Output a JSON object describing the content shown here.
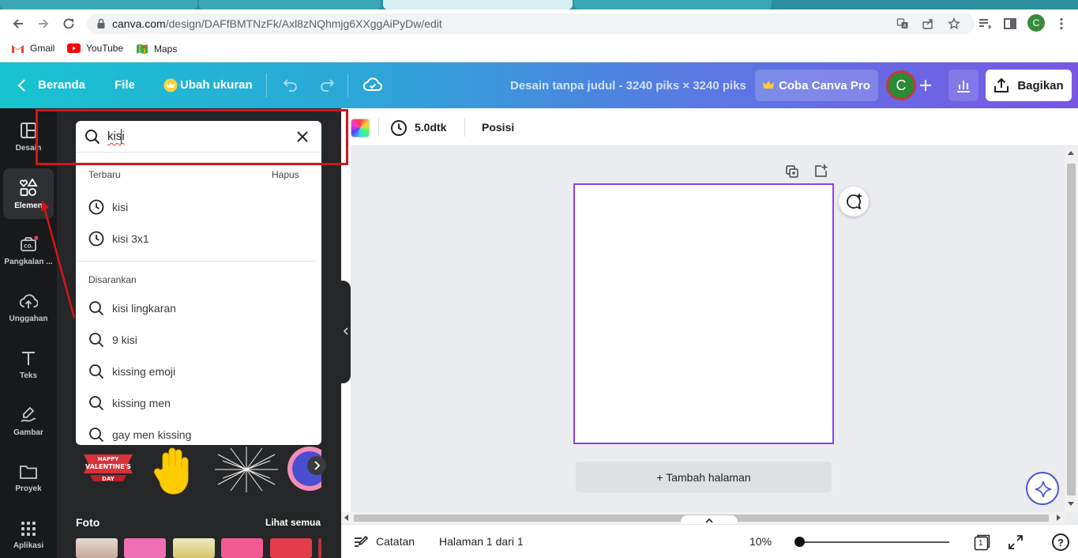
{
  "browser": {
    "url_host": "canva.com",
    "url_path": "/design/DAFfBMTNzFk/Axl8zNQhmjg6XXggAiPyDw/edit",
    "profile_initial": "C",
    "bookmarks": [
      {
        "label": "Gmail",
        "icon": "gmail-icon"
      },
      {
        "label": "YouTube",
        "icon": "youtube-icon"
      },
      {
        "label": "Maps",
        "icon": "maps-icon"
      }
    ]
  },
  "header": {
    "home_label": "Beranda",
    "file_label": "File",
    "resize_label": "Ubah ukuran",
    "design_title": "Desain tanpa judul - 3240 piks × 3240 piks",
    "pro_label": "Coba Canva Pro",
    "avatar_initial": "C",
    "share_label": "Bagikan"
  },
  "rail": [
    {
      "label": "Desain",
      "icon": "layout-icon"
    },
    {
      "label": "Elemen",
      "icon": "shapes-icon",
      "active": true
    },
    {
      "label": "Pangkalan ...",
      "icon": "brand-kit-icon"
    },
    {
      "label": "Unggahan",
      "icon": "cloud-upload-icon"
    },
    {
      "label": "Teks",
      "icon": "text-icon"
    },
    {
      "label": "Gambar",
      "icon": "draw-icon"
    },
    {
      "label": "Proyek",
      "icon": "folder-icon"
    },
    {
      "label": "Aplikasi",
      "icon": "apps-grid-icon"
    }
  ],
  "search": {
    "value": "kisi",
    "recent_heading": "Terbaru",
    "clear_label": "Hapus",
    "recent": [
      "kisi",
      "kisi 3x1"
    ],
    "suggested_heading": "Disarankan",
    "suggested": [
      "kisi lingkaran",
      "9 kisi",
      "kissing emoji",
      "kissing men",
      "gay men kissing"
    ]
  },
  "panel": {
    "sticker_text": "HAPPY VALENTINE'S DAY",
    "photos_heading": "Foto",
    "see_all_label": "Lihat semua"
  },
  "toolbar": {
    "duration_label": "5.0dtk",
    "position_label": "Posisi"
  },
  "canvas": {
    "add_page_label": "+ Tambah halaman"
  },
  "footer": {
    "notes_label": "Catatan",
    "page_indicator": "Halaman 1 dari 1",
    "zoom_label": "10%",
    "zoom_level": 0.1,
    "page_count": "1",
    "help_label": "?"
  },
  "colors": {
    "header_gradient_start": "#17c4d0",
    "header_gradient_end": "#7857e4",
    "selection": "#8b3dff",
    "annotation_red": "#d4151b",
    "panel_bg": "#252627",
    "rail_bg": "#18191b"
  }
}
